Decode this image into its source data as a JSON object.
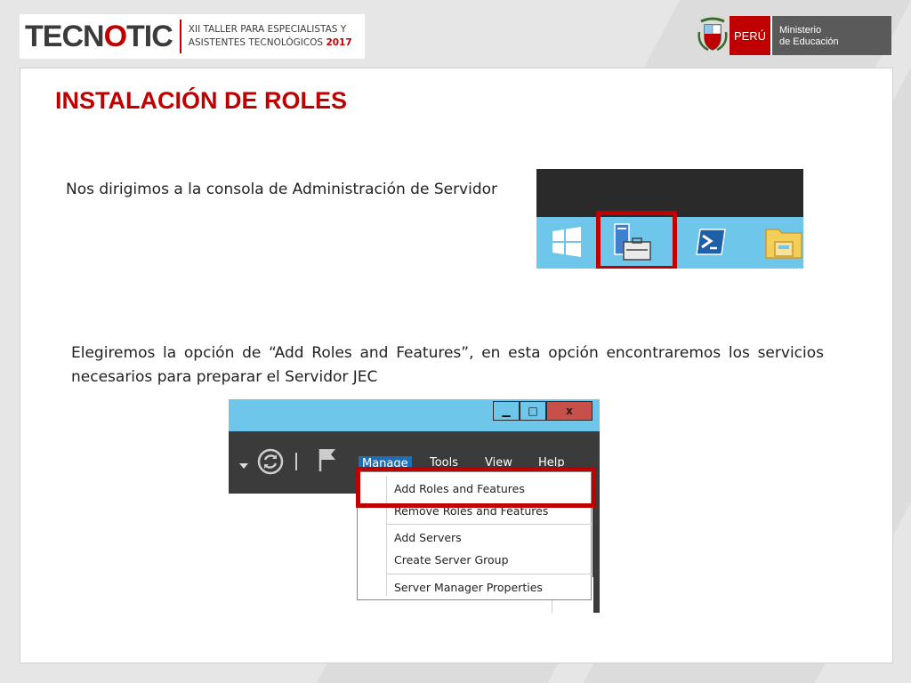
{
  "header": {
    "logo_text_a": "TECN",
    "logo_text_o": "O",
    "logo_text_b": "TIC",
    "workshop_line1": "XII TALLER PARA  ESPECIALISTAS  Y",
    "workshop_line2": "ASISTENTES TECNOLÓGICOS",
    "workshop_year": "2017",
    "country": "PERÚ",
    "ministry_line1": "Ministerio",
    "ministry_line2": "de Educación"
  },
  "slide": {
    "title": "INSTALACIÓN DE ROLES",
    "paragraph1": "Nos dirigimos a la consola de Administración de Servidor",
    "paragraph2": "Elegiremos la opción de “Add Roles and Features”, en esta opción encontraremos los servicios necesarios para preparar el Servidor JEC"
  },
  "server_manager": {
    "window_buttons": {
      "minimize": "▁",
      "maximize": "□",
      "close": "x"
    },
    "menu": [
      "Manage",
      "Tools",
      "View",
      "Help"
    ],
    "dropdown_items": [
      "Add Roles and Features",
      "Remove Roles and Features",
      "Add Servers",
      "Create Server Group",
      "Server Manager Properties"
    ]
  },
  "icons": {
    "taskbar": [
      "windows-start-icon",
      "server-manager-icon",
      "powershell-icon",
      "file-explorer-icon"
    ],
    "toolbar": [
      "dropdown-arrow-icon",
      "refresh-icon",
      "flag-icon"
    ]
  },
  "colors": {
    "accent_red": "#c00000",
    "taskbar_blue": "#6ec6ea",
    "menu_highlight": "#1f6fb5"
  }
}
